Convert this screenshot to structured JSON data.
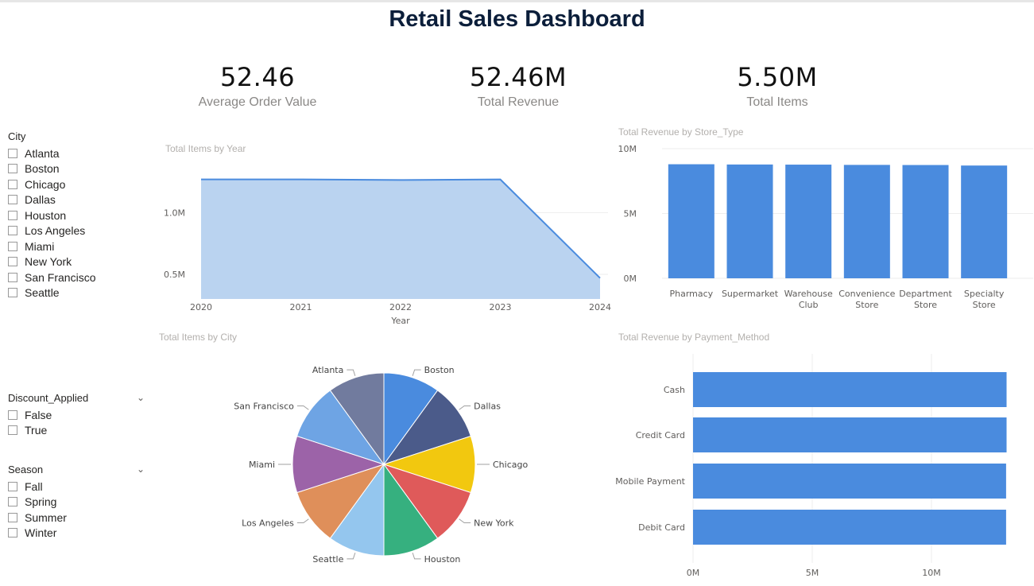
{
  "dashboard": {
    "title": "Retail Sales Dashboard"
  },
  "kpis": [
    {
      "value": "52.46",
      "label": "Average Order Value"
    },
    {
      "value": "52.46M",
      "label": "Total Revenue"
    },
    {
      "value": "5.50M",
      "label": "Total Items"
    }
  ],
  "slicers": {
    "city": {
      "title": "City",
      "options": [
        "Atlanta",
        "Boston",
        "Chicago",
        "Dallas",
        "Houston",
        "Los Angeles",
        "Miami",
        "New York",
        "San Francisco",
        "Seattle"
      ]
    },
    "discount": {
      "title": "Discount_Applied",
      "chevron": "chevron-down-icon",
      "options": [
        "False",
        "True"
      ]
    },
    "season": {
      "title": "Season",
      "chevron": "chevron-down-icon",
      "options": [
        "Fall",
        "Spring",
        "Summer",
        "Winter"
      ]
    }
  },
  "colors": {
    "accent": "#4a8bde",
    "area_fill": "#bad3f0",
    "title_text": "#0b1e3a"
  },
  "chart_data": [
    {
      "id": "items_by_year",
      "type": "area",
      "title": "Total Items by Year",
      "xlabel": "Year",
      "ylabel": "",
      "x": [
        2020,
        2021,
        2022,
        2023,
        2024
      ],
      "values": [
        1.27,
        1.27,
        1.265,
        1.27,
        0.47
      ],
      "unit": "M",
      "yticks": [
        "0.5M",
        "1.0M"
      ],
      "ytick_values": [
        0.5,
        1.0
      ],
      "ylim": [
        0.3,
        1.5
      ]
    },
    {
      "id": "revenue_by_store_type",
      "type": "bar",
      "title": "Total Revenue by Store_Type",
      "categories": [
        [
          "Pharmacy"
        ],
        [
          "Supermarket"
        ],
        [
          "Warehouse",
          "Club"
        ],
        [
          "Convenience",
          "Store"
        ],
        [
          "Department",
          "Store"
        ],
        [
          "Specialty",
          "Store"
        ]
      ],
      "values": [
        8.8,
        8.78,
        8.77,
        8.75,
        8.74,
        8.7
      ],
      "unit": "M",
      "yticks": [
        "0M",
        "5M",
        "10M"
      ],
      "ytick_values": [
        0,
        5,
        10
      ],
      "ylim": [
        0,
        10
      ]
    },
    {
      "id": "items_by_city",
      "type": "pie",
      "title": "Total Items by City",
      "labels": [
        "Boston",
        "Dallas",
        "Chicago",
        "New York",
        "Houston",
        "Seattle",
        "Los Angeles",
        "Miami",
        "San Francisco",
        "Atlanta"
      ],
      "values": [
        0.55,
        0.55,
        0.55,
        0.55,
        0.55,
        0.55,
        0.55,
        0.55,
        0.55,
        0.55
      ],
      "colors": [
        "#4a8bde",
        "#4b5b8a",
        "#f2c80f",
        "#df5a5a",
        "#36b07f",
        "#94c6ee",
        "#df8f5a",
        "#9c63a8",
        "#6ea4e4",
        "#717b9e"
      ]
    },
    {
      "id": "revenue_by_payment",
      "type": "bar",
      "orientation": "horizontal",
      "title": "Total Revenue by Payment_Method",
      "categories": [
        "Cash",
        "Credit Card",
        "Mobile Payment",
        "Debit Card"
      ],
      "values": [
        13.15,
        13.15,
        13.13,
        13.13
      ],
      "unit": "M",
      "xticks": [
        "0M",
        "5M",
        "10M"
      ],
      "xtick_values": [
        0,
        5,
        10
      ],
      "xlim": [
        0,
        15
      ]
    }
  ]
}
